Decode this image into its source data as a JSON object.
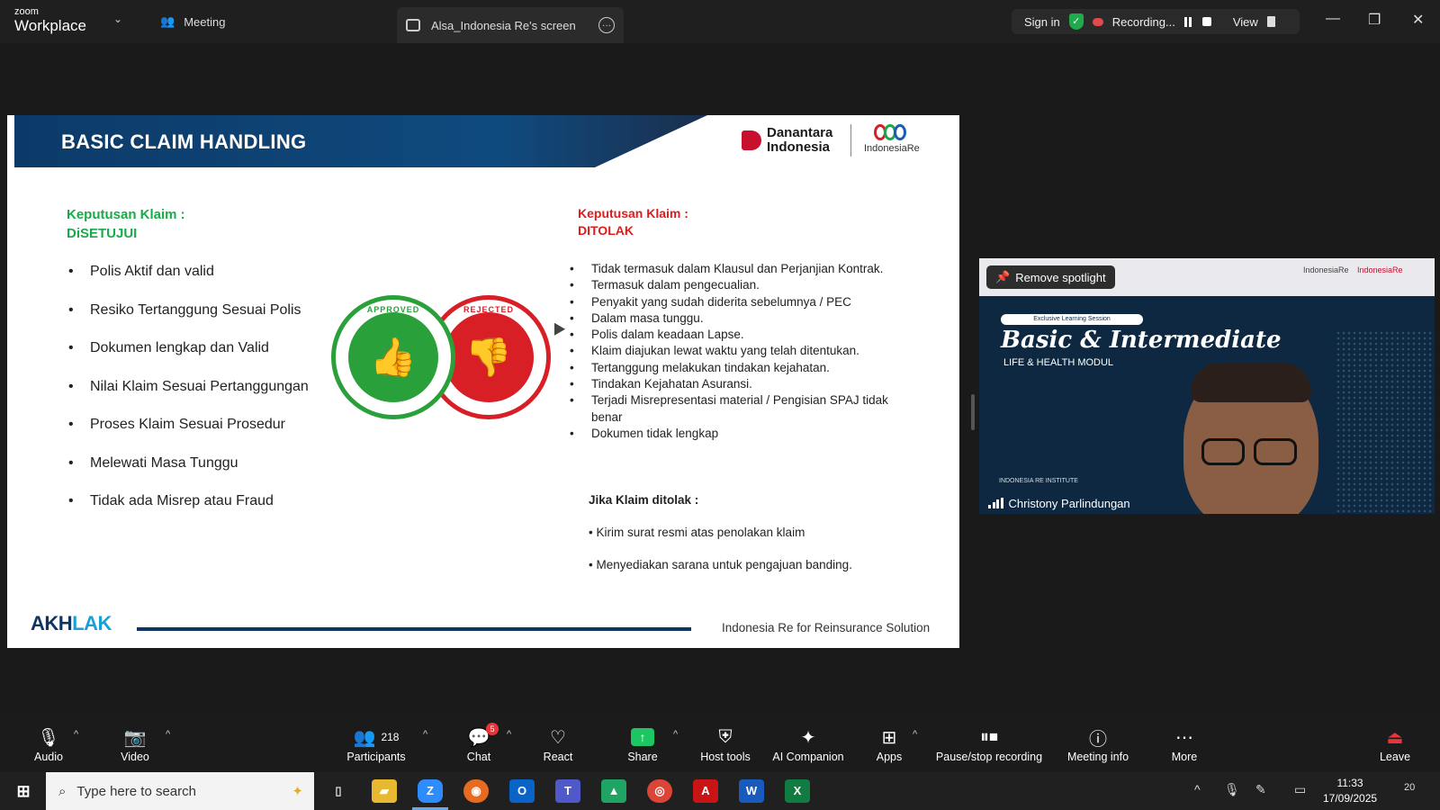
{
  "titlebar": {
    "logo_small": "zoom",
    "logo_big": "Workplace",
    "meeting_tab": "Meeting",
    "screen_tab": "Alsa_Indonesia Re's screen",
    "sign_in": "Sign in",
    "recording": "Recording...",
    "view": "View"
  },
  "slide": {
    "title": "BASIC CLAIM HANDLING",
    "brand_danantara": "Danantara Indonesia",
    "brand_indonesiare": "IndonesiaRe",
    "approved": {
      "heading1": "Keputusan Klaim :",
      "heading2": "DiSETUJUI",
      "items": [
        "Polis Aktif dan valid",
        "Resiko Tertanggung Sesuai Polis",
        "Dokumen lengkap dan Valid",
        "Nilai Klaim Sesuai Pertanggungan",
        "Proses Klaim Sesuai Prosedur",
        "Melewati Masa Tunggu",
        "Tidak ada Misrep atau Fraud"
      ]
    },
    "rejected": {
      "heading1": "Keputusan Klaim :",
      "heading2": "DITOLAK",
      "items": [
        "Tidak termasuk dalam Klausul dan Perjanjian Kontrak.",
        "Termasuk dalam pengecualian.",
        "Penyakit yang sudah diderita sebelumnya / PEC",
        "Dalam masa tunggu.",
        "Polis dalam keadaan Lapse.",
        "Klaim diajukan lewat waktu yang telah ditentukan.",
        "Tertanggung melakukan tindakan kejahatan.",
        "Tindakan Kejahatan Asuransi.",
        "Terjadi Misrepresentasi material / Pengisian SPAJ tidak benar",
        "Dokumen tidak lengkap"
      ],
      "sub_heading": "Jika Klaim ditolak :",
      "sub_items": [
        "• Kirim surat resmi atas penolakan klaim",
        "• Menyediakan sarana untuk pengajuan banding."
      ]
    },
    "stamp_approved": "APPROVED",
    "stamp_rejected": "REJECTED",
    "footer_logo_a": "AKH",
    "footer_logo_b": "LAK",
    "footer_text": "Indonesia Re for Reinsurance Solution"
  },
  "video": {
    "remove_spotlight": "Remove spotlight",
    "brand_right": "IndonesiaRe",
    "pill": "Exclusive Learning Session",
    "title": "Basic & Intermediate",
    "subtitle": "LIFE & HEALTH MODUL",
    "institute": "INDONESIA RE INSTITUTE",
    "participant": "Christony Parlindungan"
  },
  "toolbar": {
    "audio": "Audio",
    "video": "Video",
    "participants": "Participants",
    "participant_count": "218",
    "chat": "Chat",
    "chat_badge": "5",
    "react": "React",
    "share": "Share",
    "host_tools": "Host tools",
    "ai_companion": "AI Companion",
    "apps": "Apps",
    "pause_stop": "Pause/stop recording",
    "meeting_info": "Meeting info",
    "more": "More",
    "leave": "Leave"
  },
  "taskbar": {
    "search_placeholder": "Type here to search",
    "time": "11:33",
    "date": "17/09/2025",
    "notif_count": "20"
  },
  "colors": {
    "approved_green": "#1aaa4b",
    "rejected_red": "#e01b1b",
    "banner_blue": "#0f4a7e",
    "share_green": "#1ec563"
  }
}
